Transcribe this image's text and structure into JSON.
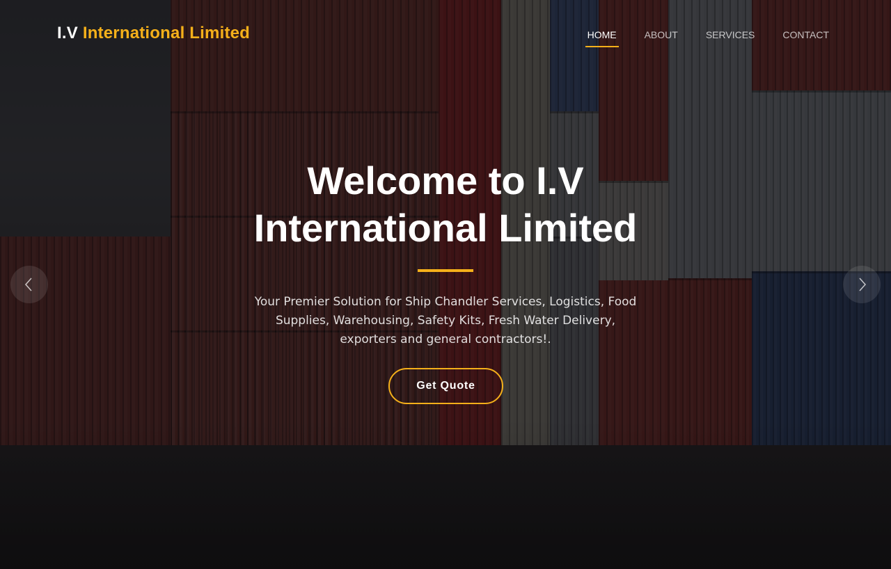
{
  "brand": {
    "prefix": "I.V",
    "name": "International Limited",
    "accent_color": "#f5b01a"
  },
  "nav": {
    "items": [
      {
        "label": "HOME",
        "active": true
      },
      {
        "label": "ABOUT",
        "active": false
      },
      {
        "label": "SERVICES",
        "active": false
      },
      {
        "label": "CONTACT",
        "active": false
      }
    ]
  },
  "hero": {
    "title_line1": "Welcome to I.V",
    "title_line2": "International Limited",
    "subtitle": "Your Premier Solution for Ship Chandler Services, Logistics, Food Supplies, Warehousing, Safety Kits, Fresh Water Delivery, exporters and general contractors!.",
    "cta_label": "Get Quote"
  },
  "carousel": {
    "prev_icon": "chevron-left-icon",
    "next_icon": "chevron-right-icon"
  }
}
